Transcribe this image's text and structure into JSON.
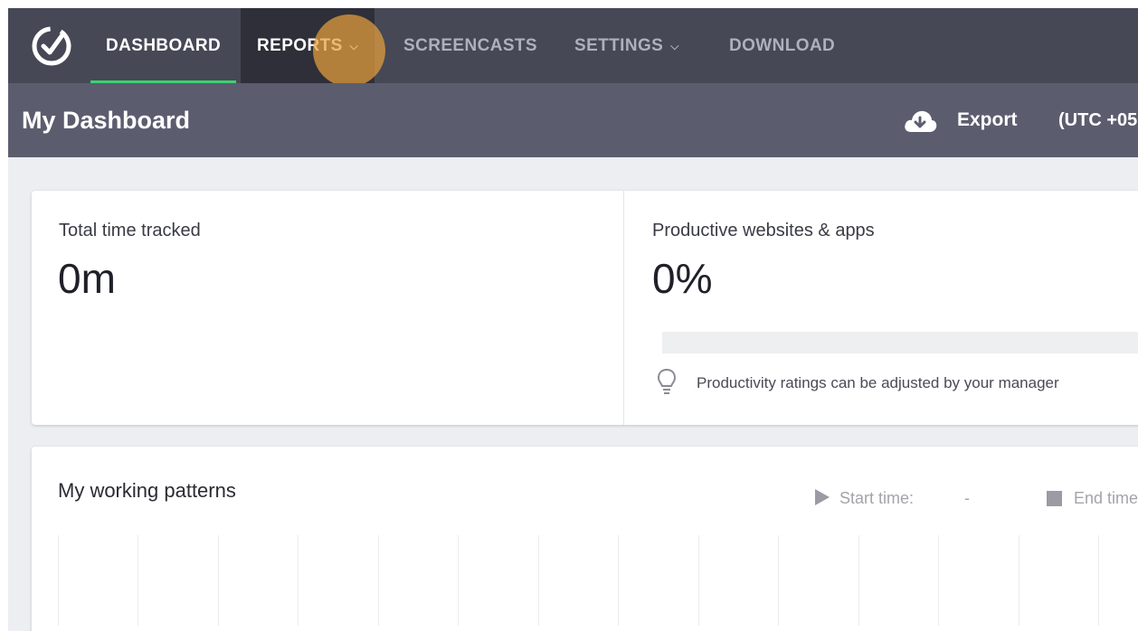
{
  "nav": {
    "items": [
      {
        "label": "DASHBOARD",
        "active": true
      },
      {
        "label": "REPORTS",
        "has_dropdown": true,
        "highlighted": true
      },
      {
        "label": "SCREENCASTS"
      },
      {
        "label": "SETTINGS",
        "has_dropdown": true
      },
      {
        "label": "DOWNLOAD"
      }
    ],
    "logo_icon": "clock-check-logo-icon"
  },
  "header": {
    "title": "My Dashboard",
    "export_label": "Export",
    "export_icon": "cloud-download-icon",
    "timezone": "(UTC +05"
  },
  "stats": {
    "total_time_label": "Total time tracked",
    "total_time_value": "0m",
    "productive_label": "Productive websites & apps",
    "productive_value": "0%",
    "productive_fraction": 0,
    "hint_icon": "lightbulb-icon",
    "hint": "Productivity ratings can be adjusted by your manager"
  },
  "patterns": {
    "title": "My working patterns",
    "start_label": "Start time:",
    "start_value": "-",
    "end_label": "End time"
  },
  "colors": {
    "nav_bg": "#464856",
    "subheader_bg": "#5b5d6f",
    "accent_green": "#3ecf74",
    "click_highlight": "#e6a03c"
  }
}
